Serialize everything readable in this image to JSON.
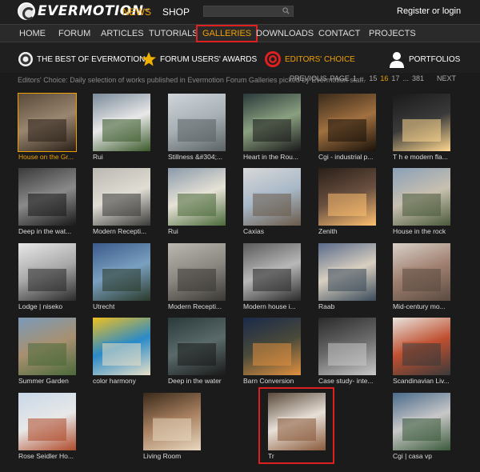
{
  "header": {
    "logo_text": "EVERMOTION",
    "logo_tm": "™",
    "news": "NEWS",
    "shop": "SHOP",
    "search_placeholder": "",
    "register": "Register or login"
  },
  "nav": [
    "HOME",
    "FORUM",
    "ARTICLES",
    "TUTORIALS",
    "GALLERIES",
    "DOWNLOADS",
    "CONTACT",
    "PROJECTS"
  ],
  "subnav": [
    {
      "label": "THE BEST OF EVERMOTION",
      "icon": "evermotion-logo-icon"
    },
    {
      "label": "FORUM USERS' AWARDS",
      "icon": "star-icon"
    },
    {
      "label": "EDITORS' CHOICE",
      "icon": "target-icon"
    },
    {
      "label": "PORTFOLIOS",
      "icon": "user-icon"
    }
  ],
  "caption": "Editors' Choice: Daily selection of works published in Evermotion Forum Galleries picked by Evermotion staff.",
  "pager": {
    "previous": "PREVIOUS",
    "page": "PAGE",
    "first": "1",
    "ellipsis1": "...",
    "p15": "15",
    "p16": "16",
    "p17": "17",
    "ellipsis2": "...",
    "last": "381",
    "next": "NEXT"
  },
  "gallery": [
    {
      "label": "House on the Gr...",
      "colors": [
        "#5a4a3a",
        "#9a8670",
        "#2a2018"
      ]
    },
    {
      "label": "Rui",
      "colors": [
        "#7a8a9a",
        "#e8e8e8",
        "#3a5a2a"
      ]
    },
    {
      "label": "Stillness &#304;...",
      "colors": [
        "#cfd5da",
        "#a8b0b5",
        "#5b6266"
      ]
    },
    {
      "label": "Heart in the Rou...",
      "colors": [
        "#2a3a3a",
        "#8aa080",
        "#1a1a1a"
      ]
    },
    {
      "label": "Cgi - industrial p...",
      "colors": [
        "#3a2a1a",
        "#a07040",
        "#1a120a"
      ]
    },
    {
      "label": "T h e modern fla...",
      "colors": [
        "#1a1a1a",
        "#3a3a3a",
        "#ffd890"
      ]
    },
    {
      "label": "Deep in the wat...",
      "colors": [
        "#3a3a3a",
        "#8a8a8a",
        "#1a1a1a"
      ]
    },
    {
      "label": "Modern Recepti...",
      "colors": [
        "#bab8b0",
        "#e0ddd5",
        "#3a3a38"
      ]
    },
    {
      "label": "Rui",
      "colors": [
        "#8a9aaa",
        "#e6e2d6",
        "#4a6a3a"
      ]
    },
    {
      "label": "Caxias",
      "colors": [
        "#d8d8d8",
        "#a8b8c8",
        "#6a5a4a"
      ]
    },
    {
      "label": "Zenith",
      "colors": [
        "#2a1f18",
        "#6a5040",
        "#ffc070"
      ]
    },
    {
      "label": "House in the rock",
      "colors": [
        "#8aa0b8",
        "#c8c0b0",
        "#4a5a3a"
      ]
    },
    {
      "label": "Lodge | niseko",
      "colors": [
        "#e8e8e8",
        "#a8a8a8",
        "#2a2a2a"
      ]
    },
    {
      "label": "Utrecht",
      "colors": [
        "#3a5a8a",
        "#7aa0c0",
        "#2a3a2a"
      ]
    },
    {
      "label": "Modern Recepti...",
      "colors": [
        "#bab8b0",
        "#8a8680",
        "#3a3834"
      ]
    },
    {
      "label": "Modern house i...",
      "colors": [
        "#5a5a5a",
        "#b8b8b8",
        "#2a2a2a"
      ]
    },
    {
      "label": "Raab",
      "colors": [
        "#5a6a8a",
        "#d8d0c0",
        "#3a4a5a"
      ]
    },
    {
      "label": "Mid-century mo...",
      "colors": [
        "#d8d0c8",
        "#a08070",
        "#5a4a40"
      ]
    },
    {
      "label": "Summer Garden",
      "colors": [
        "#7a9ab8",
        "#a89070",
        "#4a6a3a"
      ]
    },
    {
      "label": "color harmony",
      "colors": [
        "#f0c020",
        "#2a8ac8",
        "#e8e0c8"
      ]
    },
    {
      "label": "Deep in the water",
      "colors": [
        "#2a3a3a",
        "#5a6a6a",
        "#1a1a1a"
      ]
    },
    {
      "label": "Barn Conversion",
      "colors": [
        "#1a2a4a",
        "#4a4a3a",
        "#e09040"
      ]
    },
    {
      "label": "Case study- inte...",
      "colors": [
        "#2a2a2a",
        "#6a6a6a",
        "#c8c8c8"
      ]
    },
    {
      "label": "Scandinavian Liv...",
      "colors": [
        "#e8e4de",
        "#c05030",
        "#3a3a3a"
      ]
    },
    {
      "label": "Rose Seidler Ho...",
      "colors": [
        "#c8d8e8",
        "#e8e8e8",
        "#b04a2a"
      ]
    },
    {
      "label": "Living Room",
      "colors": [
        "#3a2a1a",
        "#a88060",
        "#e8d8c0"
      ]
    },
    {
      "label": "Tr",
      "colors": [
        "#5a4a3a",
        "#e8e0d8",
        "#8a5a3a"
      ]
    },
    {
      "label": "Cgi | casa vp",
      "colors": [
        "#4a6a8a",
        "#c8c8c8",
        "#3a5a3a"
      ]
    }
  ]
}
